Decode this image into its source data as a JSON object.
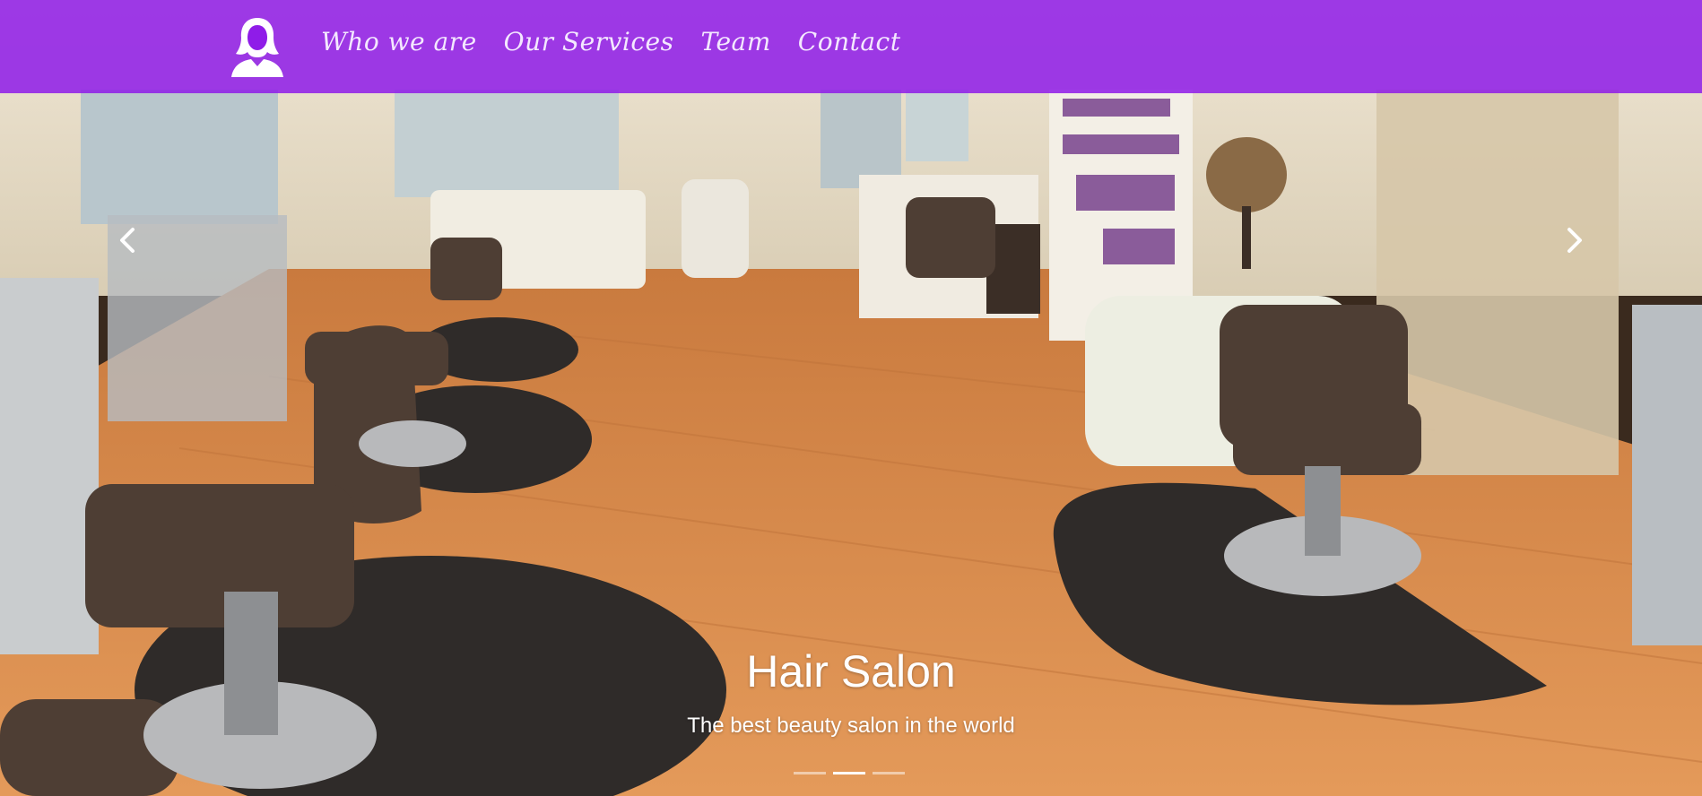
{
  "nav": {
    "logo": "woman-silhouette-logo",
    "links": [
      "Who we are",
      "Our Services",
      "Team",
      "Contact"
    ]
  },
  "carousel": {
    "prev_icon": "chevron-left-icon",
    "next_icon": "chevron-right-icon",
    "title": "Hair Salon",
    "subtitle": "The best beauty salon in the world",
    "slide_count": 3,
    "active_slide": 2
  },
  "colors": {
    "navbar": "#8f1ce8",
    "floor": "#d98a4a",
    "text": "#ffffff"
  }
}
